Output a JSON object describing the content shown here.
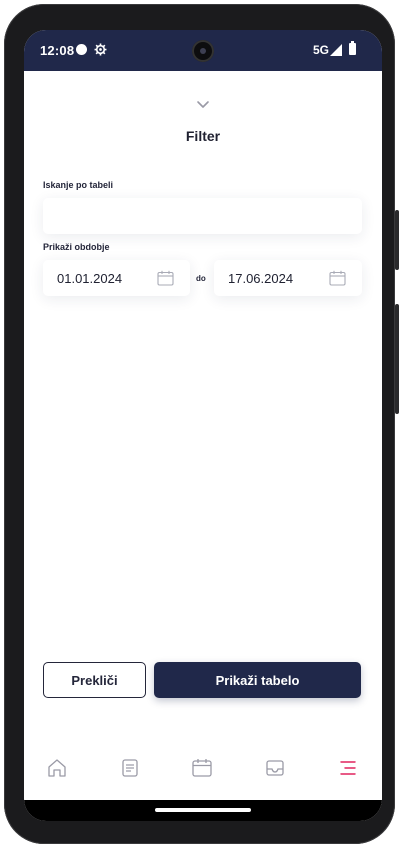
{
  "status_bar": {
    "time": "12:08",
    "network": "5G",
    "icons": [
      "circle-dot-icon",
      "gear-icon",
      "camera-icon",
      "signal-icon",
      "battery-icon"
    ]
  },
  "sheet": {
    "handle_icon": "chevron-down-icon",
    "title": "Filter"
  },
  "search": {
    "label": "Iskanje po tabeli",
    "value": "",
    "placeholder": ""
  },
  "period": {
    "label": "Prikaži obdobje",
    "from": "01.01.2024",
    "separator": "do",
    "to": "17.06.2024",
    "icon": "calendar-icon"
  },
  "actions": {
    "cancel_label": "Prekliči",
    "submit_label": "Prikaži tabelo"
  },
  "bottom_nav": {
    "items": [
      {
        "icon": "home-icon",
        "active": false
      },
      {
        "icon": "document-list-icon",
        "active": false
      },
      {
        "icon": "calendar-icon",
        "active": false
      },
      {
        "icon": "inbox-icon",
        "active": false
      },
      {
        "icon": "menu-icon",
        "active": true
      }
    ]
  },
  "colors": {
    "primary": "#20284a",
    "active_nav": "#e0245e",
    "inactive_nav": "#9a9aa6",
    "background": "#ffffff"
  }
}
